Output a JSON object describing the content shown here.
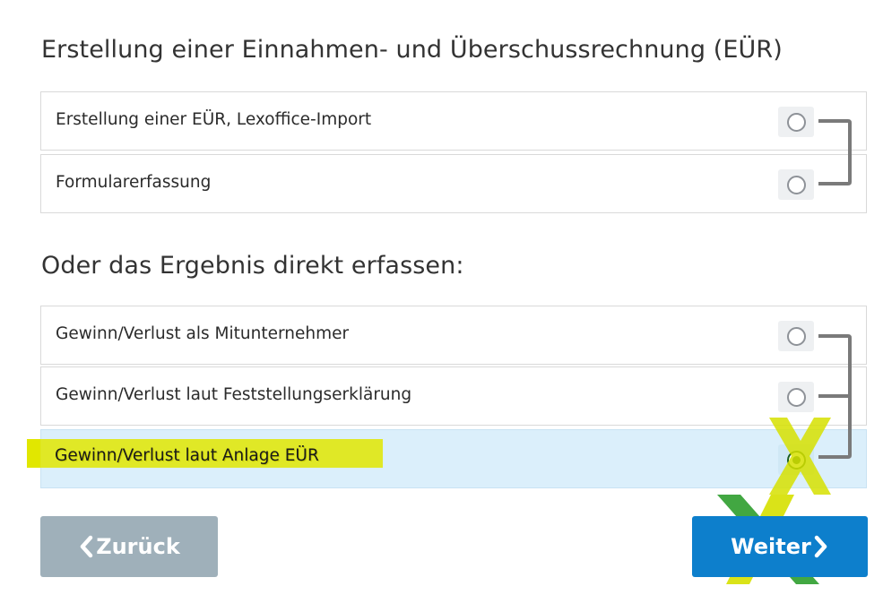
{
  "section1": {
    "title": "Erstellung einer Einnahmen- und Überschussrechnung (EÜR)",
    "options": [
      {
        "label": "Erstellung einer EÜR, Lexoffice-Import",
        "selected": false
      },
      {
        "label": "Formularerfassung",
        "selected": false
      }
    ]
  },
  "section2": {
    "title": "Oder das Ergebnis direkt erfassen:",
    "options": [
      {
        "label": "Gewinn/Verlust als Mitunternehmer",
        "selected": false
      },
      {
        "label": "Gewinn/Verlust laut Feststellungserklärung",
        "selected": false
      },
      {
        "label": "Gewinn/Verlust laut Anlage EÜR",
        "selected": true
      }
    ]
  },
  "buttons": {
    "back_label": "Zurück",
    "next_label": "Weiter"
  },
  "colors": {
    "back_button": "#9fb0ba",
    "next_button": "#0d7fcc",
    "selected_row": "#dbeffb",
    "highlight_yellow": "#e1e600",
    "radio_checked": "#1b5e20"
  }
}
